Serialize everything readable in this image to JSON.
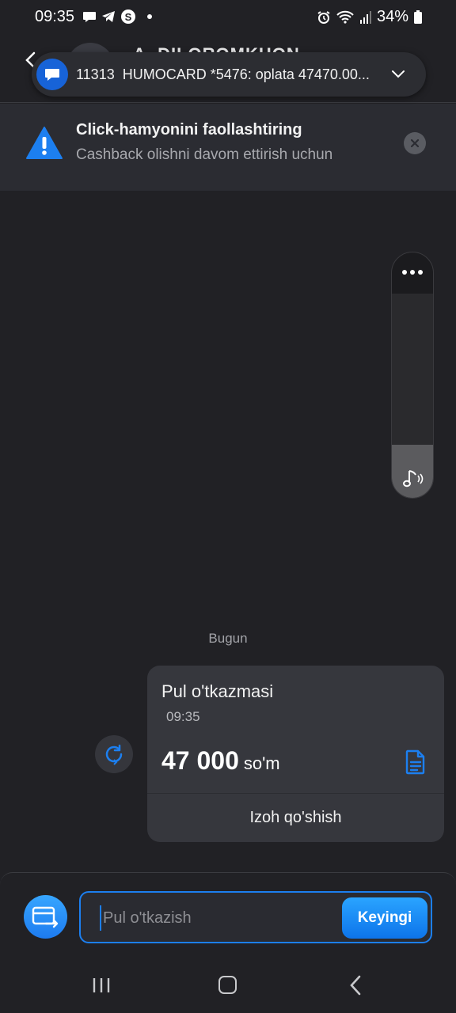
{
  "status_bar": {
    "time": "09:35",
    "battery": "34%"
  },
  "header": {
    "contact_title": "A. DILOROMKHON"
  },
  "notification": {
    "sender": "11313",
    "text": "HUMOCARD *5476: oplata 47470.00..."
  },
  "banner": {
    "title": "Click-hamyonini faollashtiring",
    "subtitle": "Cashback olishni davom ettirish uchun"
  },
  "volume": {
    "level": 0.26
  },
  "chat": {
    "date_separator": "Bugun",
    "message": {
      "title": "Pul o'tkazmasi",
      "time": "09:35",
      "amount": "47 000",
      "currency": "so'm",
      "comment_label": "Izoh qo'shish"
    }
  },
  "composer": {
    "placeholder": "Pul o'tkazish",
    "value": "",
    "next_label": "Keyingi"
  },
  "colors": {
    "accent": "#1c7ff0",
    "background": "#212125",
    "card": "#36373d"
  }
}
